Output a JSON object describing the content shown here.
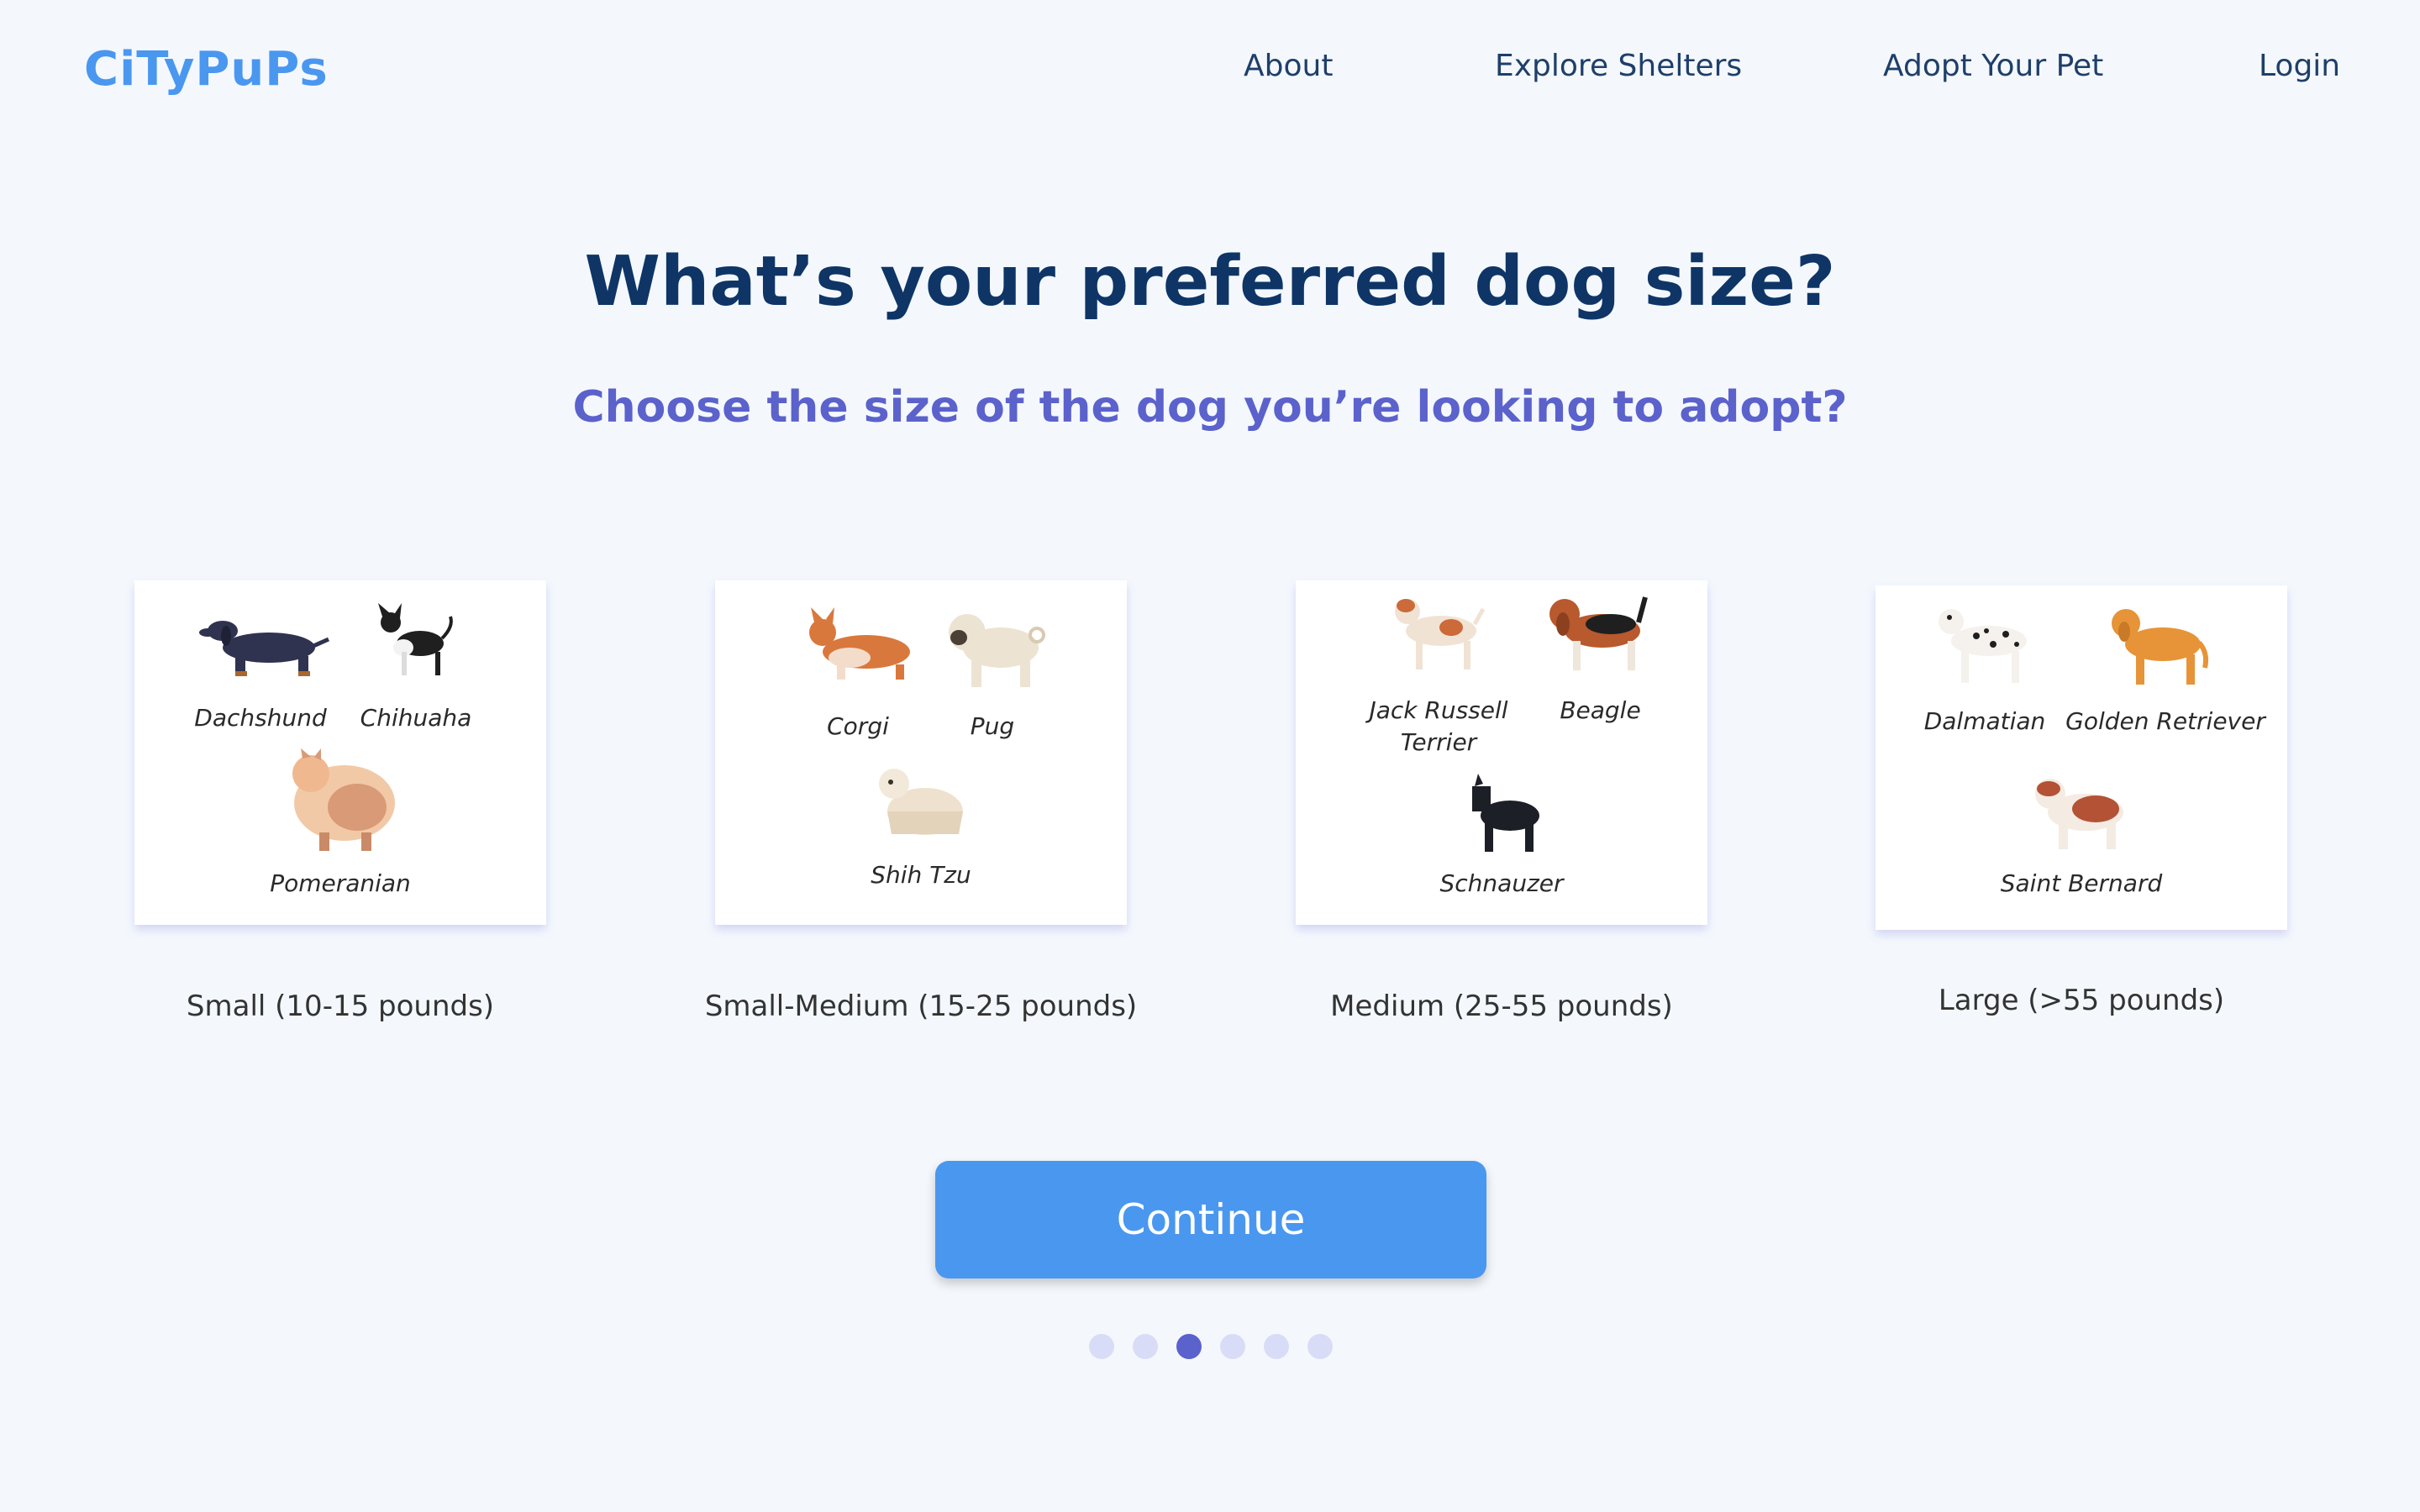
{
  "header": {
    "logo": "CiTyPuPs",
    "nav": [
      "About",
      "Explore Shelters",
      "Adopt Your Pet",
      "Login"
    ]
  },
  "main": {
    "title": "What’s your preferred dog size?",
    "subtitle": "Choose the size of the dog you’re looking to adopt?",
    "options": [
      {
        "size_label": "Small (10-15 pounds)",
        "breeds": [
          "Dachshund",
          "Chihuaha",
          "Pomeranian"
        ]
      },
      {
        "size_label": "Small-Medium (15-25 pounds)",
        "breeds": [
          "Corgi",
          "Pug",
          "Shih Tzu"
        ]
      },
      {
        "size_label": "Medium (25-55 pounds)",
        "breeds": [
          "Jack Russell Terrier",
          "Beagle",
          "Schnauzer"
        ]
      },
      {
        "size_label": "Large (>55 pounds)",
        "breeds": [
          "Dalmatian",
          "Golden Retriever",
          "Saint Bernard"
        ]
      }
    ],
    "continue_label": "Continue"
  },
  "pagination": {
    "total": 6,
    "current": 3
  },
  "colors": {
    "background": "#f4f8fd",
    "logo": "#4a97f0",
    "title": "#0e3566",
    "subtitle": "#5b62cc",
    "button": "#4a97f0",
    "dot_active": "#5b62cc",
    "dot_inactive": "#d9dcf6"
  }
}
